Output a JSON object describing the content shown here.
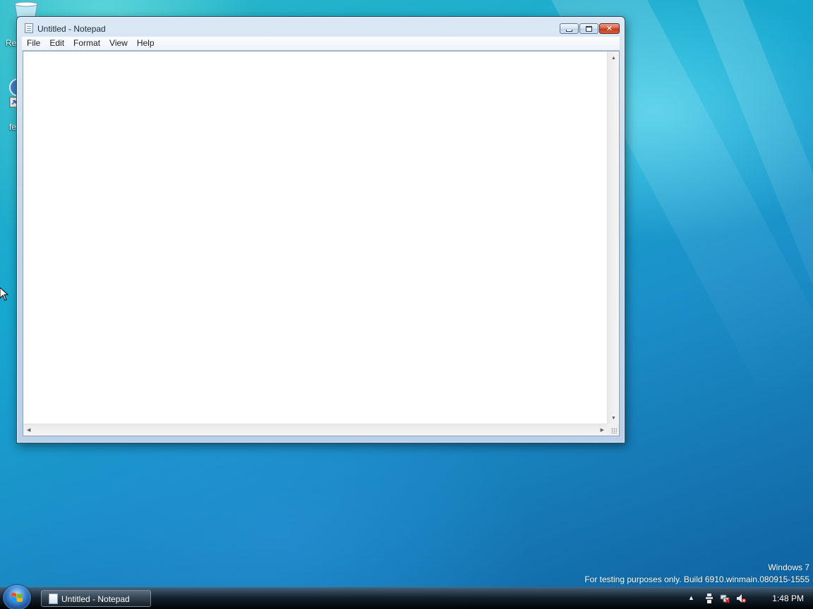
{
  "window": {
    "title": "Untitled - Notepad",
    "menu": [
      "File",
      "Edit",
      "Format",
      "View",
      "Help"
    ],
    "content": ""
  },
  "desktop": {
    "icon_label_1": "Re",
    "icon_label_2": "fe"
  },
  "watermark": {
    "line1": "Windows  7",
    "line2": "For testing purposes only. Build 6910.winmain.080915-1555"
  },
  "taskbar": {
    "task_label": "Untitled - Notepad",
    "clock": "1:48 PM"
  },
  "icons": {
    "minimize": "minimize-icon",
    "maximize": "maximize-icon",
    "close": "close-icon",
    "start": "windows-logo-icon"
  },
  "colors": {
    "close_button": "#c23b1e",
    "window_frame": "#c6d9ec",
    "desktop_accent": "#17a7cf"
  }
}
